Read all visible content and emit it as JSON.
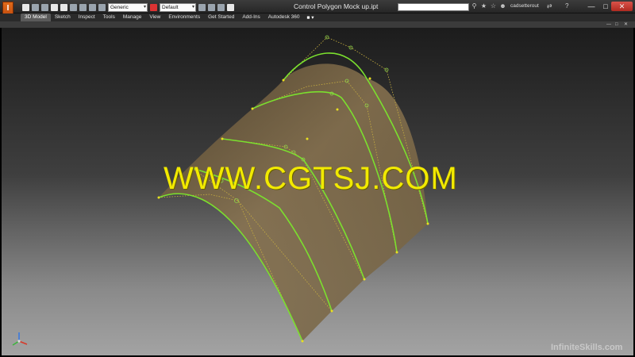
{
  "app": {
    "logo_letter": "I",
    "window_title": "Control Polygon Mock up.ipt"
  },
  "toolbar": {
    "material_combo": "Generic",
    "appearance_combo": "Default"
  },
  "account": {
    "user_name": "cadsetterout"
  },
  "window_controls": {
    "minimize": "—",
    "maximize": "□",
    "close": "✕"
  },
  "ribbon": {
    "tabs": [
      "3D Model",
      "Sketch",
      "Inspect",
      "Tools",
      "Manage",
      "View",
      "Environments",
      "Get Started",
      "Add-Ins",
      "Autodesk 360"
    ],
    "active_tab": "3D Model",
    "extra": "■ ▾"
  },
  "viewport": {
    "overlay_text": "WWW.CGTSJ.COM",
    "brand_text": "InfiniteSkills.com",
    "curve_color": "#7be02e",
    "surface_color": "#7a6540"
  }
}
